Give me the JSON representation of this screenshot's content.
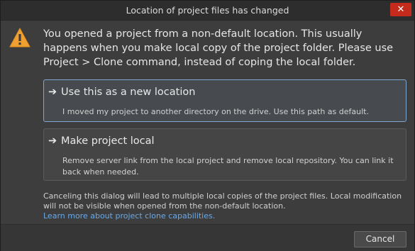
{
  "dialog": {
    "title": "Location of project files has changed",
    "close_glyph": "✕",
    "message": "You opened a project from a non-default location. This usually happens when you make local copy of the project folder. Please use Project > Clone command, instead of coping the local folder."
  },
  "options": [
    {
      "arrow": "➔",
      "title": "Use this as a new location",
      "description": "I moved my project to another directory on the drive. Use this path as default."
    },
    {
      "arrow": "➔",
      "title": "Make project local",
      "description": "Remove server link from the local project and remove local repository. You can link it back when needed."
    }
  ],
  "footer": {
    "text": "Canceling this dialog will lead to multiple local copies of the project files. Local modification will not be visible when opened from the non-default location.",
    "link": "Learn more about project clone capabilities."
  },
  "buttons": {
    "cancel": "Cancel"
  },
  "colors": {
    "accent_border": "#7fa6cf",
    "close_red": "#c42b1c",
    "warning": "#f0a030",
    "link": "#6aa9e8"
  },
  "icons": {
    "warning": "warning-icon",
    "close": "close-icon",
    "arrow": "arrow-right-icon"
  }
}
